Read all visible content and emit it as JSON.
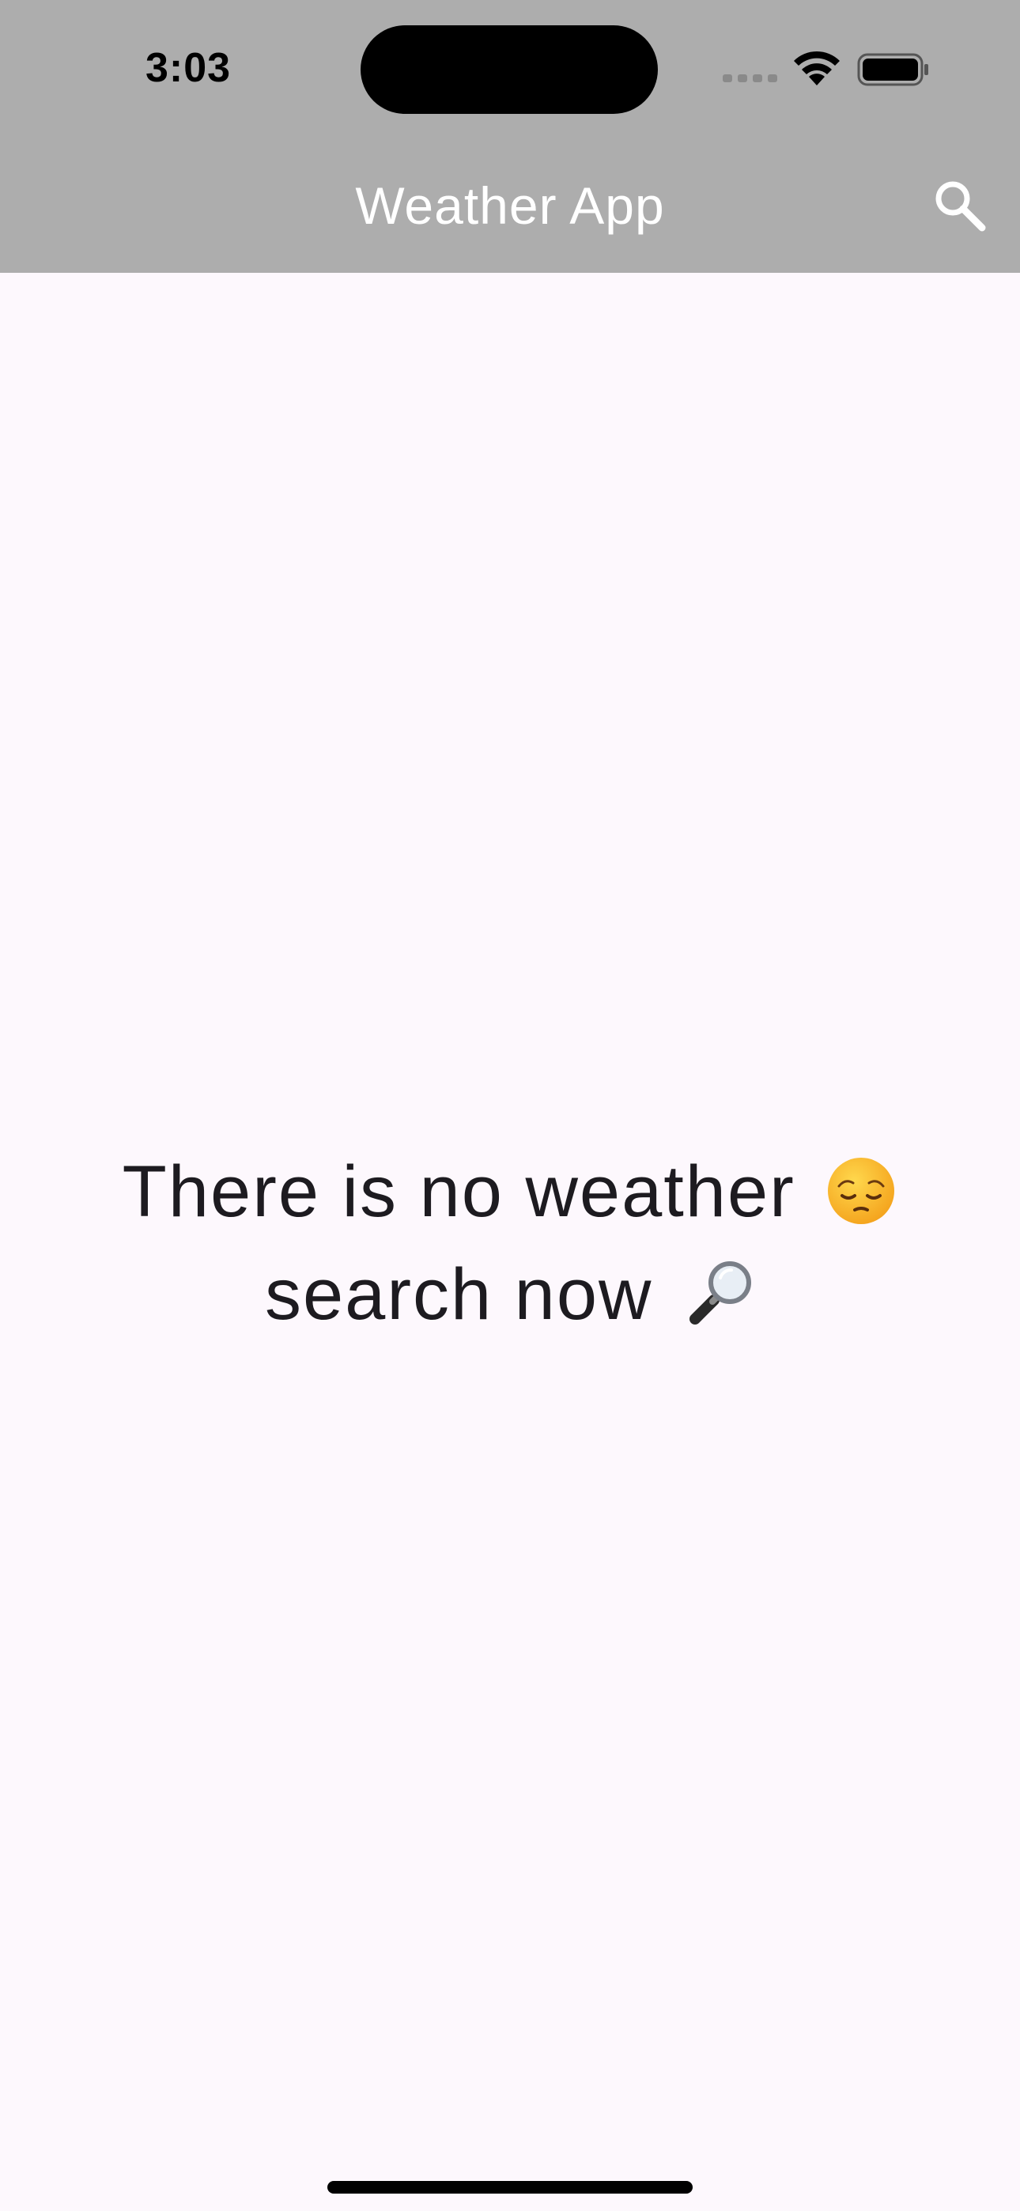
{
  "status_bar": {
    "time": "3:03"
  },
  "app_bar": {
    "title": "Weather App",
    "search_icon": "search-icon"
  },
  "empty_state": {
    "line1": "There is no weather",
    "line1_emoji": "pensive-face-icon",
    "line2": "search now",
    "line2_emoji": "magnifying-glass-icon"
  },
  "colors": {
    "app_bar_background": "#adadad",
    "page_background": "#fdf8fd",
    "text": "#1d1b20",
    "app_bar_text": "#ffffff"
  }
}
